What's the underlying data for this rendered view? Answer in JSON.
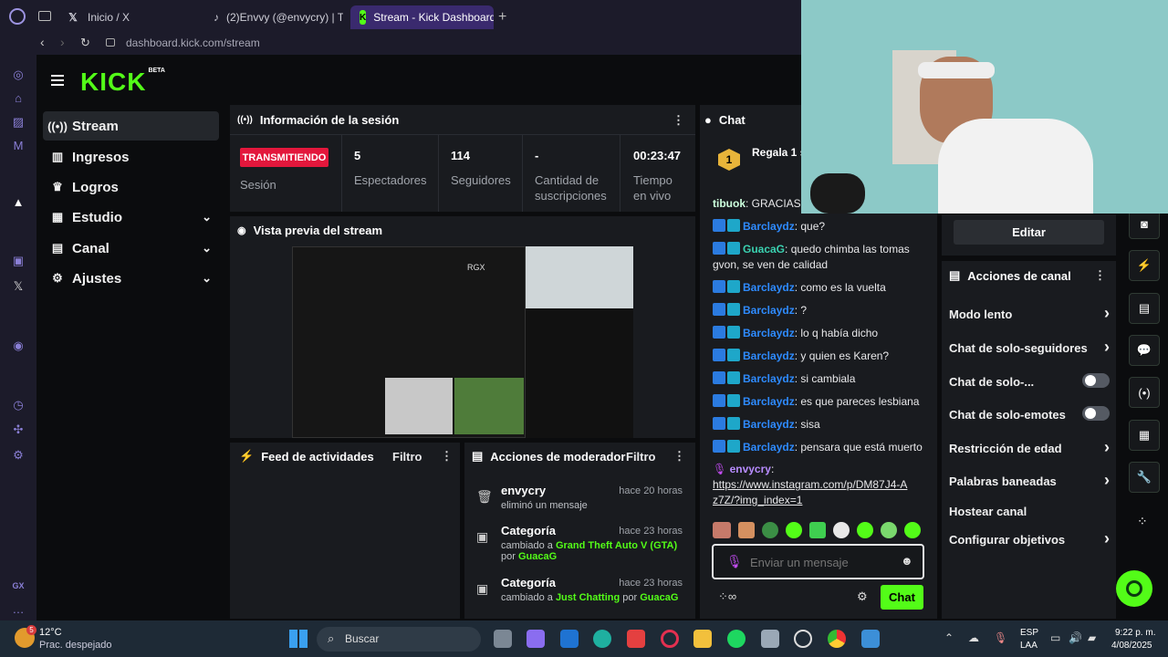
{
  "browser": {
    "tabs": [
      {
        "label": "Inicio / X"
      },
      {
        "label": "(2)Envvy (@envycry) | Ti"
      },
      {
        "label": "Stream - Kick Dashboard"
      }
    ],
    "url": "dashboard.kick.com/stream"
  },
  "logo": {
    "text": "KICK",
    "beta": "BETA"
  },
  "nav": [
    {
      "label": "Stream",
      "icon": "broadcast-icon"
    },
    {
      "label": "Ingresos",
      "icon": "chart-icon"
    },
    {
      "label": "Logros",
      "icon": "trophy-icon"
    },
    {
      "label": "Estudio",
      "icon": "palette-icon"
    },
    {
      "label": "Canal",
      "icon": "channel-icon"
    },
    {
      "label": "Ajustes",
      "icon": "gear-icon"
    }
  ],
  "session": {
    "title": "Información de la sesión",
    "status": "TRANSMITIENDO",
    "status_label": "Sesión",
    "viewers": "5",
    "viewers_label": "Espectadores",
    "followers": "114",
    "followers_label": "Seguidores",
    "subs": "-",
    "subs_label": "Cantidad de suscripciones",
    "uptime": "00:23:47",
    "uptime_label": "Tiempo en vivo"
  },
  "preview": {
    "title": "Vista previa del stream",
    "rgx": "RGX"
  },
  "activity": {
    "title": "Feed de actividades",
    "filter": "Filtro"
  },
  "mod": {
    "title": "Acciones de moderador",
    "filter": "Filtro",
    "items": [
      {
        "title": "envycry",
        "time": "hace 20 horas",
        "sub": "eliminó un mensaje"
      },
      {
        "title": "Categoría",
        "time": "hace 23 horas",
        "sub_pre": "cambiado a ",
        "sub_hl": "Grand Theft Auto V (GTA)",
        "sub_mid": "por ",
        "sub_user": "GuacaG"
      },
      {
        "title": "Categoría",
        "time": "hace 23 horas",
        "sub_pre": "cambiado a ",
        "sub_hl": "Just Chatting",
        "sub_mid": " por ",
        "sub_user": "GuacaG"
      }
    ]
  },
  "chat": {
    "title": "Chat",
    "gift": "Regala 1 s",
    "messages": [
      {
        "user": "tibuok",
        "text": ": GRACIAS IC"
      },
      {
        "user": "Barclaydz",
        "text": ": que?"
      },
      {
        "user": "GuacaG",
        "text": ": quedo chimba las tomas gvon, se ven de calidad"
      },
      {
        "user": "Barclaydz",
        "text": ": como es la vuelta"
      },
      {
        "user": "Barclaydz",
        "text": ": ?"
      },
      {
        "user": "Barclaydz",
        "text": ": lo q había dicho"
      },
      {
        "user": "Barclaydz",
        "text": ": y quien es Karen?"
      },
      {
        "user": "Barclaydz",
        "text": ": si cambiala"
      },
      {
        "user": "Barclaydz",
        "text": ": es que pareces lesbiana"
      },
      {
        "user": "Barclaydz",
        "text": ": sisa"
      },
      {
        "user": "Barclaydz",
        "text": ": pensara que está muerto"
      }
    ],
    "last_user": "envycry",
    "last_colon": ":",
    "last_link": "https://www.instagram.com/p/DM87J4-Az7Z/?img_index=1",
    "placeholder": "Enviar un mensaje",
    "send": "Chat"
  },
  "channel": {
    "edit": "Editar",
    "title": "Acciones de canal",
    "items": [
      {
        "label": "Modo lento",
        "control": "chevron"
      },
      {
        "label": "Chat de solo-seguidores",
        "control": "chevron"
      },
      {
        "label": "Chat de solo-...",
        "control": "toggle"
      },
      {
        "label": "Chat de solo-emotes",
        "control": "toggle"
      },
      {
        "label": "Restricción de edad",
        "control": "chevron"
      },
      {
        "label": "Palabras baneadas",
        "control": "chevron"
      },
      {
        "label": "Hostear canal",
        "control": "none"
      },
      {
        "label": "Configurar objetivos",
        "control": "chevron"
      }
    ]
  },
  "taskbar": {
    "weather_temp": "12°C",
    "weather_desc": "Prac. despejado",
    "weather_badge": "5",
    "search": "Buscar",
    "lang1": "ESP",
    "lang2": "LAA",
    "time": "9:22 p. m.",
    "date": "4/08/2025"
  },
  "colors": {
    "accent": "#53fc18",
    "live": "#e3173c",
    "panel": "#191b1f",
    "background": "#0b0c0e"
  }
}
